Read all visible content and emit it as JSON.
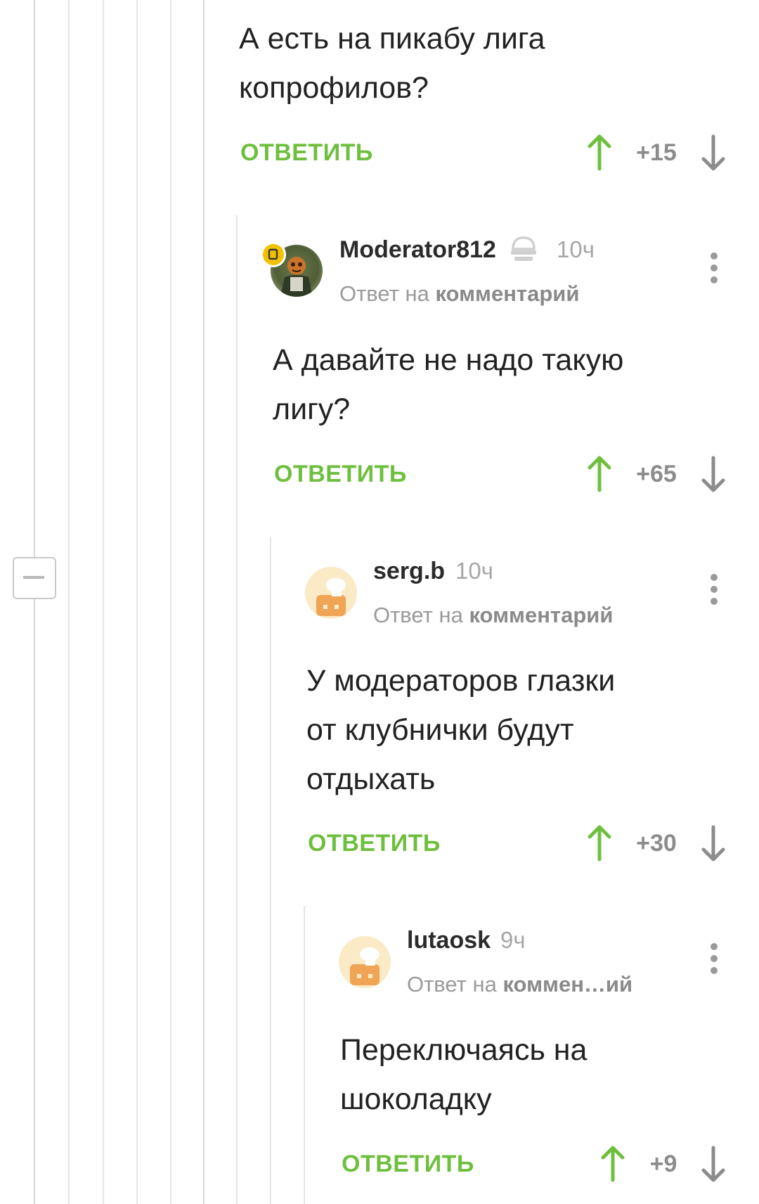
{
  "comments": [
    {
      "text_lines": [
        "А есть на пикабу лига",
        "копрофилов?"
      ],
      "reply_label": "ОТВЕТИТЬ",
      "score": "+15"
    },
    {
      "username": "Moderator812",
      "time": "10ч",
      "reply_prefix": "Ответ на",
      "reply_target": "комментарий",
      "text_lines": [
        "А давайте не надо такую",
        "лигу?"
      ],
      "reply_label": "ОТВЕТИТЬ",
      "score": "+65"
    },
    {
      "username": "serg.b",
      "time": "10ч",
      "reply_prefix": "Ответ на",
      "reply_target": "комментарий",
      "text_lines": [
        "У модераторов глазки",
        "от клубнички будут",
        "отдыхать"
      ],
      "reply_label": "ОТВЕТИТЬ",
      "score": "+30"
    },
    {
      "username": "lutaosk",
      "time": "9ч",
      "reply_prefix": "Ответ на",
      "reply_target": "коммен…ий",
      "text_lines": [
        "Переключаясь на",
        "шоколадку"
      ],
      "reply_label": "ОТВЕТИТЬ",
      "score": "+9"
    }
  ],
  "colors": {
    "accent_green": "#6fbf3f",
    "muted_gray": "#9a9a9a",
    "thread_line": "#e6e6e6"
  },
  "icons": {
    "vote_up": "arrow-up-icon",
    "vote_down": "arrow-down-icon",
    "menu": "more-vertical-icon",
    "moderator_badge": "moderator-cap-icon",
    "collapse": "minus-icon"
  }
}
